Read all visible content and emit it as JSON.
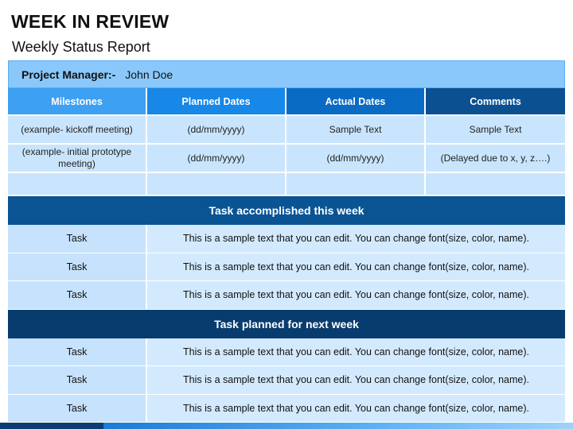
{
  "header": {
    "title": "WEEK IN REVIEW",
    "subtitle": "Weekly Status Report"
  },
  "project_manager": {
    "label": "Project Manager:-",
    "name": "John Doe"
  },
  "milestones_table": {
    "columns": [
      "Milestones",
      "Planned Dates",
      "Actual Dates",
      "Comments"
    ],
    "rows": [
      [
        "(example- kickoff meeting)",
        "(dd/mm/yyyy)",
        "Sample Text",
        "Sample Text"
      ],
      [
        "(example- initial prototype meeting)",
        "(dd/mm/yyyy)",
        "(dd/mm/yyyy)",
        "(Delayed due to x, y, z….)"
      ],
      [
        "",
        "",
        "",
        ""
      ]
    ]
  },
  "accomplished": {
    "heading": "Task accomplished this week",
    "rows": [
      {
        "task": "Task",
        "text": "This is a sample text that you can edit. You can change font(size, color, name)."
      },
      {
        "task": "Task",
        "text": "This is a sample text that you can edit. You can change font(size, color, name)."
      },
      {
        "task": "Task",
        "text": "This is a sample text that you can edit. You can change font(size, color, name)."
      }
    ]
  },
  "planned": {
    "heading": "Task planned for next week",
    "rows": [
      {
        "task": "Task",
        "text": "This is a sample text that you can edit. You can change font(size, color, name)."
      },
      {
        "task": "Task",
        "text": "This is a sample text that you can edit. You can change font(size, color, name)."
      },
      {
        "task": "Task",
        "text": "This is a sample text that you can edit. You can change font(size, color, name)."
      }
    ]
  },
  "colors": {
    "header_1": "#3ea0f2",
    "header_2": "#1787e8",
    "header_3": "#0a6bc4",
    "header_4": "#0b5191",
    "section_accomplished": "#0a5494",
    "section_planned": "#093c6e",
    "cell_light": "#c9e5fd"
  }
}
